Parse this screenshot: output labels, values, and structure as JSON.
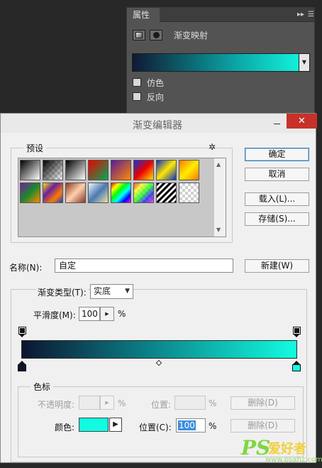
{
  "properties_panel": {
    "tab_label": "属性",
    "collapse_glyph": "▸▸",
    "menu_glyph": "☰",
    "title": "渐变映射",
    "gradient_colors": [
      "#0f1a33",
      "#0ba8a8",
      "#13fde2"
    ],
    "options": [
      {
        "label": "仿色",
        "checked": false
      },
      {
        "label": "反向",
        "checked": false
      }
    ]
  },
  "dialog": {
    "title": "渐变编辑器",
    "close_glyph": "✕",
    "presets": {
      "label": "预设",
      "gear_glyph": "✲",
      "swatches": [
        {
          "name": "foreground-to-background",
          "css": "linear-gradient(135deg,#000 0%,#fff 100%)"
        },
        {
          "name": "foreground-to-transparent",
          "css": "linear-gradient(135deg,#000 0%,rgba(0,0,0,0) 100%)"
        },
        {
          "name": "black-white",
          "css": "linear-gradient(135deg,#000 0%,#fff 100%)"
        },
        {
          "name": "red-green",
          "css": "linear-gradient(135deg,#e00 0%,#0a5 100%)"
        },
        {
          "name": "violet-orange",
          "css": "linear-gradient(135deg,#5a1a9a 0%,#ff8a00 100%)"
        },
        {
          "name": "blue-red-yellow",
          "css": "linear-gradient(135deg,#1330d0 0%,#e00 50%,#ffe000 100%)"
        },
        {
          "name": "blue-yellow-blue",
          "css": "linear-gradient(135deg,#1030c0 0%,#ffe800 50%,#1030c0 100%)"
        },
        {
          "name": "orange-yellow-orange",
          "css": "linear-gradient(135deg,#ff7a00 0%,#ffee00 50%,#ff7a00 100%)"
        },
        {
          "name": "violet-green-orange",
          "css": "linear-gradient(135deg,#7a1aa0 0%,#1a8a2a 50%,#ff8a00 100%)"
        },
        {
          "name": "yellow-violet-orange-blue",
          "css": "linear-gradient(135deg,#ffe000 0%,#6a20a0 35%,#ff7a00 70%,#1a40d0 100%)"
        },
        {
          "name": "copper",
          "css": "linear-gradient(135deg,#8a3a20 0%,#ffd0b0 50%,#8a3a20 100%)"
        },
        {
          "name": "chrome",
          "css": "linear-gradient(135deg,#f0f8ff 0%,#4a7ab0 50%,#f0e0a0 100%)"
        },
        {
          "name": "spectrum",
          "css": "linear-gradient(135deg,#f00 0%,#ff0 20%,#0f0 40%,#0ff 60%,#00f 80%,#f0f 100%)"
        },
        {
          "name": "transparent-rainbow",
          "css": "linear-gradient(135deg,rgba(255,0,0,0.7) 0%,rgba(255,255,0,0.7) 25%,rgba(0,255,0,0.7) 50%,rgba(0,0,255,0.7) 75%,rgba(255,0,255,0.7) 100%)"
        },
        {
          "name": "transparent-stripes",
          "css": "repeating-linear-gradient(135deg,#000 0px,#000 3px,#fff 3px,#fff 6px)"
        },
        {
          "name": "transparent",
          "css": "linear-gradient(135deg,rgba(0,0,0,0) 0%,rgba(0,0,0,0) 100%)"
        }
      ]
    },
    "buttons": {
      "ok": "确定",
      "cancel": "取消",
      "load": "载入(L)...",
      "save": "存储(S)...",
      "new": "新建(W)"
    },
    "name_label": "名称(N):",
    "name_value": "自定",
    "type_label": "渐变类型(T):",
    "type_value": "实底",
    "smoothness_label": "平滑度(M):",
    "smoothness_value": "100",
    "percent_symbol": "%",
    "gradient_stops": {
      "opacity_stops": [
        0,
        100
      ],
      "color_stops": [
        {
          "location": 0,
          "color": "#0c1530"
        },
        {
          "location": 100,
          "color": "#12fbe0"
        }
      ],
      "midpoint": 50
    },
    "stops_section": {
      "label": "色标",
      "opacity_label": "不透明度:",
      "opacity_value": "",
      "location_label_top": "位置:",
      "location_top_value": "",
      "delete_label": "删除(D)",
      "color_label": "颜色:",
      "selected_color": "#12fbe0",
      "location_label": "位置(C):",
      "location_value": "100"
    }
  },
  "watermark": {
    "brand": "PS",
    "text": "爱好者",
    "url": "www.psahz.com"
  }
}
